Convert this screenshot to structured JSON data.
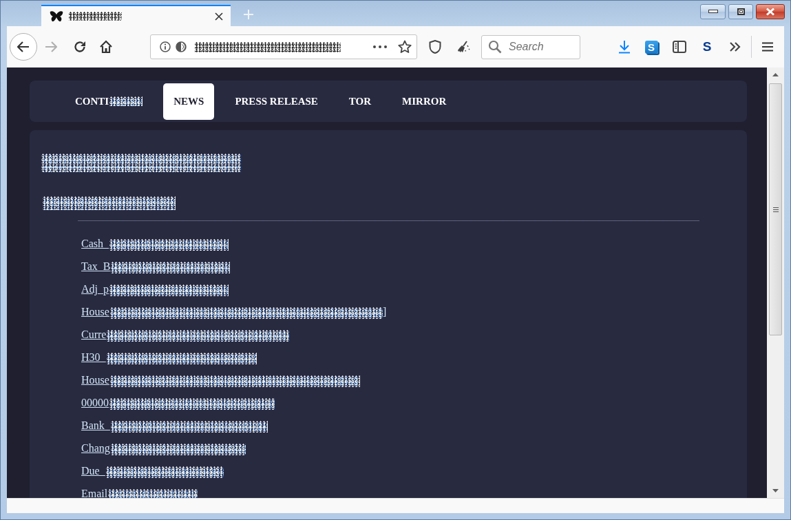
{
  "window": {
    "tabs": [
      {
        "selected": true,
        "title_redacted": true
      }
    ]
  },
  "toolbar": {
    "url_redacted": true,
    "search": {
      "placeholder": "Search"
    },
    "extension_tile": "S",
    "extension_letter": "S"
  },
  "page": {
    "nav": [
      {
        "label": "CONTI",
        "redacted": true,
        "selected": false
      },
      {
        "label": "NEWS",
        "redacted": false,
        "selected": true
      },
      {
        "label": "PRESS RELEASE",
        "redacted": false,
        "selected": false
      },
      {
        "label": "TOR",
        "redacted": false,
        "selected": false
      },
      {
        "label": "MIRROR",
        "redacted": false,
        "selected": false
      }
    ],
    "heading": {
      "redacted": true
    },
    "subheading": {
      "redacted": true
    },
    "links": [
      {
        "text": "Cash_",
        "redacted": true
      },
      {
        "text": "Tax_B",
        "redacted": true
      },
      {
        "text": "Adj_p",
        "redacted": true
      },
      {
        "text": "House",
        "redacted": true,
        "trailing_text": "]"
      },
      {
        "text": "Curre",
        "redacted": true
      },
      {
        "text": "H30_",
        "redacted": true
      },
      {
        "text": "House",
        "redacted": true
      },
      {
        "text": "00000",
        "redacted": true
      },
      {
        "text": "Bank_",
        "redacted": true
      },
      {
        "text": "Chang",
        "redacted": true
      },
      {
        "text": "Due_",
        "redacted": true
      },
      {
        "text": "Email",
        "redacted": true
      }
    ]
  }
}
